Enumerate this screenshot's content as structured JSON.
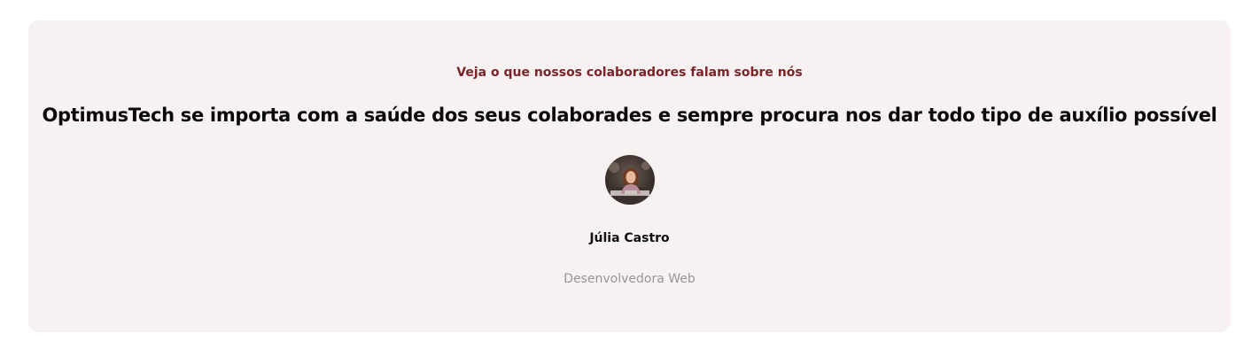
{
  "testimonial": {
    "eyebrow": "Veja o que nossos colaboradores falam sobre nós",
    "quote": "OptimusTech se importa com a saúde dos seus colaborades e sempre procura nos dar todo tipo de auxílio possível",
    "author": {
      "name": "Júlia Castro",
      "role": "Desenvolvedora Web"
    }
  },
  "colors": {
    "card_background": "#f8f1f1",
    "eyebrow": "#7b2328",
    "headline": "#0a0a0a",
    "role": "#9a9595"
  }
}
